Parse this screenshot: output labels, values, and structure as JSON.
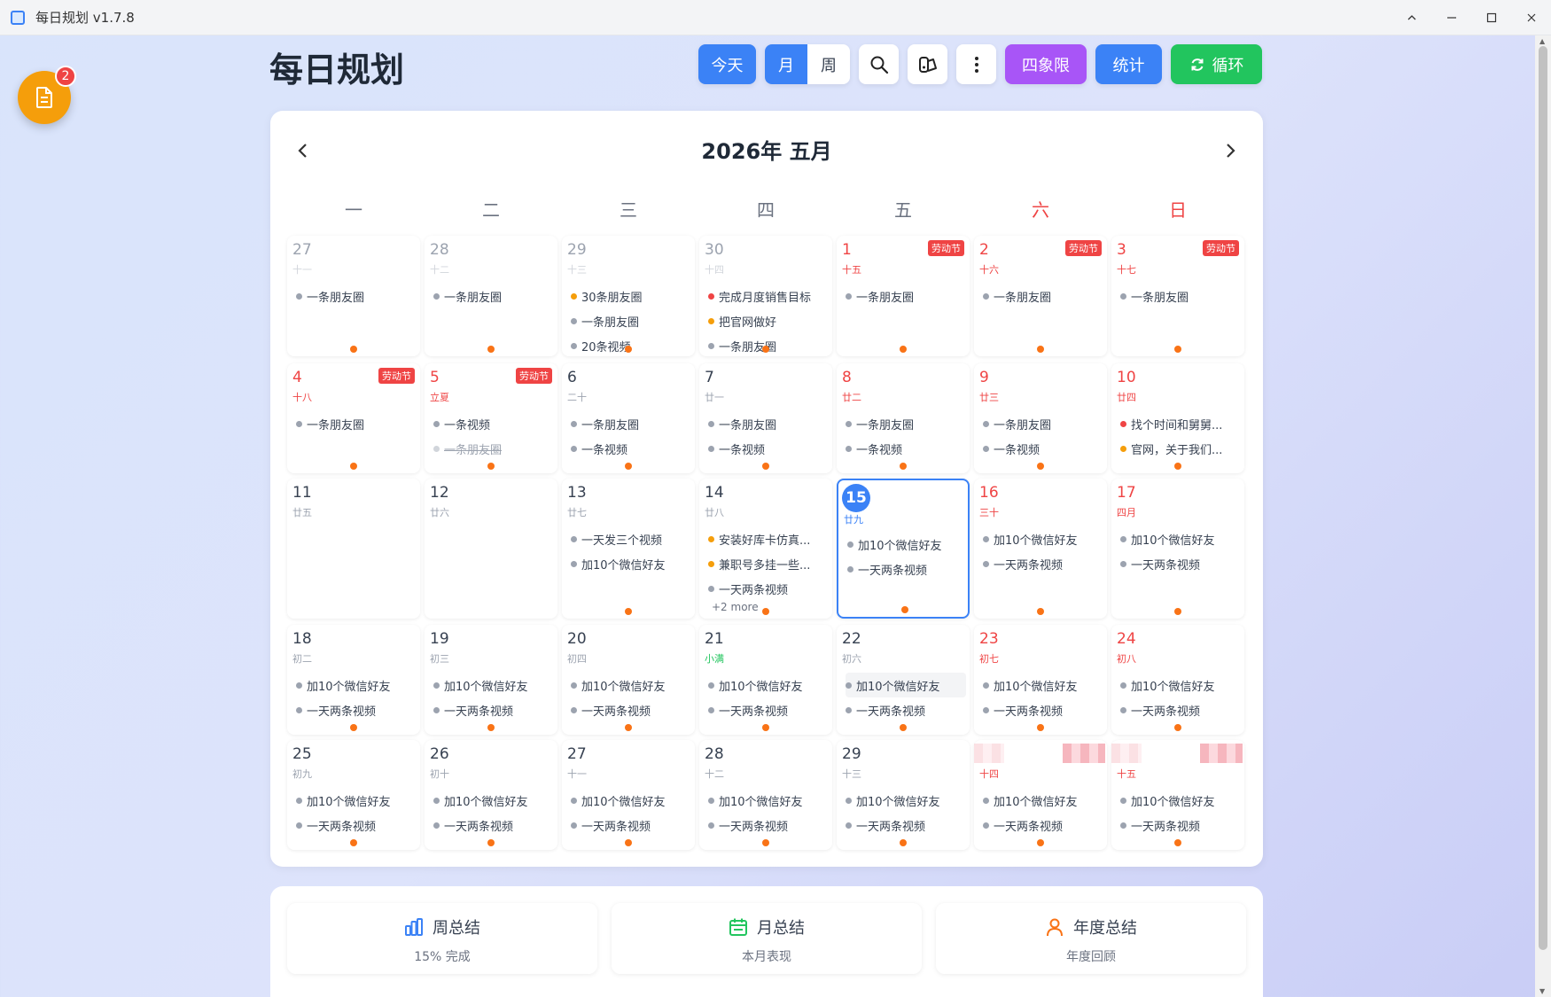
{
  "window": {
    "title": "每日规划 v1.7.8"
  },
  "float_badge": "2",
  "header": {
    "title": "每日规划",
    "today": "今天",
    "month": "月",
    "week": "周",
    "quadrant": "四象限",
    "stats": "统计",
    "cycle": "循环"
  },
  "calendar": {
    "title": "2026年 五月",
    "weekdays": [
      "一",
      "二",
      "三",
      "四",
      "五",
      "六",
      "日"
    ],
    "holiday_label": "劳动节",
    "more_label": "+2 more",
    "cells": [
      {
        "d": "27",
        "l": "十一",
        "tasks": [
          [
            "g",
            "一条朋友圈"
          ]
        ]
      },
      {
        "d": "28",
        "l": "十二",
        "tasks": [
          [
            "g",
            "一条朋友圈"
          ]
        ]
      },
      {
        "d": "29",
        "l": "十三",
        "tasks": [
          [
            "y",
            "30条朋友圈"
          ],
          [
            "g",
            "一条朋友圈"
          ],
          [
            "g",
            "20条视频"
          ]
        ]
      },
      {
        "d": "30",
        "l": "十四",
        "tasks": [
          [
            "r",
            "完成月度销售目标"
          ],
          [
            "y",
            "把官网做好"
          ],
          [
            "g",
            "一条朋友圈"
          ]
        ]
      },
      {
        "d": "1",
        "l": "十五",
        "tasks": [
          [
            "g",
            "一条朋友圈"
          ]
        ]
      },
      {
        "d": "2",
        "l": "十六",
        "tasks": [
          [
            "g",
            "一条朋友圈"
          ]
        ]
      },
      {
        "d": "3",
        "l": "十七",
        "tasks": [
          [
            "g",
            "一条朋友圈"
          ]
        ]
      },
      {
        "d": "4",
        "l": "十八",
        "tasks": [
          [
            "g",
            "一条朋友圈"
          ]
        ]
      },
      {
        "d": "5",
        "l": "立夏",
        "tasks": [
          [
            "g",
            "一条视频"
          ],
          [
            "x",
            "一条朋友圈"
          ]
        ]
      },
      {
        "d": "6",
        "l": "二十",
        "tasks": [
          [
            "g",
            "一条朋友圈"
          ],
          [
            "g",
            "一条视频"
          ]
        ]
      },
      {
        "d": "7",
        "l": "廿一",
        "tasks": [
          [
            "g",
            "一条朋友圈"
          ],
          [
            "g",
            "一条视频"
          ]
        ]
      },
      {
        "d": "8",
        "l": "廿二",
        "tasks": [
          [
            "g",
            "一条朋友圈"
          ],
          [
            "g",
            "一条视频"
          ]
        ]
      },
      {
        "d": "9",
        "l": "廿三",
        "tasks": [
          [
            "g",
            "一条朋友圈"
          ],
          [
            "g",
            "一条视频"
          ]
        ]
      },
      {
        "d": "10",
        "l": "廿四",
        "tasks": [
          [
            "r",
            "找个时间和舅舅..."
          ],
          [
            "y",
            "官网，关于我们..."
          ]
        ]
      },
      {
        "d": "11",
        "l": "廿五",
        "tasks": []
      },
      {
        "d": "12",
        "l": "廿六",
        "tasks": []
      },
      {
        "d": "13",
        "l": "廿七",
        "tasks": [
          [
            "g",
            "一天发三个视频"
          ],
          [
            "g",
            "加10个微信好友"
          ]
        ]
      },
      {
        "d": "14",
        "l": "廿八",
        "tasks": [
          [
            "y",
            "安装好库卡仿真..."
          ],
          [
            "y",
            "兼职号多挂一些..."
          ],
          [
            "g",
            "一天两条视频"
          ]
        ]
      },
      {
        "d": "15",
        "l": "廿九",
        "tasks": [
          [
            "g",
            "加10个微信好友"
          ],
          [
            "g",
            "一天两条视频"
          ]
        ]
      },
      {
        "d": "16",
        "l": "三十",
        "tasks": [
          [
            "g",
            "加10个微信好友"
          ],
          [
            "g",
            "一天两条视频"
          ]
        ]
      },
      {
        "d": "17",
        "l": "四月",
        "tasks": [
          [
            "g",
            "加10个微信好友"
          ],
          [
            "g",
            "一天两条视频"
          ]
        ]
      },
      {
        "d": "18",
        "l": "初二",
        "tasks": [
          [
            "g",
            "加10个微信好友"
          ],
          [
            "g",
            "一天两条视频"
          ]
        ]
      },
      {
        "d": "19",
        "l": "初三",
        "tasks": [
          [
            "g",
            "加10个微信好友"
          ],
          [
            "g",
            "一天两条视频"
          ]
        ]
      },
      {
        "d": "20",
        "l": "初四",
        "tasks": [
          [
            "g",
            "加10个微信好友"
          ],
          [
            "g",
            "一天两条视频"
          ]
        ]
      },
      {
        "d": "21",
        "l": "小满",
        "tasks": [
          [
            "g",
            "加10个微信好友"
          ],
          [
            "g",
            "一天两条视频"
          ]
        ]
      },
      {
        "d": "22",
        "l": "初六",
        "tasks": [
          [
            "g",
            "加10个微信好友"
          ],
          [
            "g",
            "一天两条视频"
          ]
        ]
      },
      {
        "d": "23",
        "l": "初七",
        "tasks": [
          [
            "g",
            "加10个微信好友"
          ],
          [
            "g",
            "一天两条视频"
          ]
        ]
      },
      {
        "d": "24",
        "l": "初八",
        "tasks": [
          [
            "g",
            "加10个微信好友"
          ],
          [
            "g",
            "一天两条视频"
          ]
        ]
      },
      {
        "d": "25",
        "l": "初九",
        "tasks": [
          [
            "g",
            "加10个微信好友"
          ],
          [
            "g",
            "一天两条视频"
          ]
        ]
      },
      {
        "d": "26",
        "l": "初十",
        "tasks": [
          [
            "g",
            "加10个微信好友"
          ],
          [
            "g",
            "一天两条视频"
          ]
        ]
      },
      {
        "d": "27",
        "l": "十一",
        "tasks": [
          [
            "g",
            "加10个微信好友"
          ],
          [
            "g",
            "一天两条视频"
          ]
        ]
      },
      {
        "d": "28",
        "l": "十二",
        "tasks": [
          [
            "g",
            "加10个微信好友"
          ],
          [
            "g",
            "一天两条视频"
          ]
        ]
      },
      {
        "d": "29",
        "l": "十三",
        "tasks": [
          [
            "g",
            "加10个微信好友"
          ],
          [
            "g",
            "一天两条视频"
          ]
        ]
      },
      {
        "d": "",
        "l": "十四",
        "tasks": [
          [
            "g",
            "加10个微信好友"
          ],
          [
            "g",
            "一天两条视频"
          ]
        ]
      },
      {
        "d": "",
        "l": "十五",
        "tasks": [
          [
            "g",
            "加10个微信好友"
          ],
          [
            "g",
            "一天两条视频"
          ]
        ]
      }
    ]
  },
  "summary": {
    "week": {
      "title": "周总结",
      "sub": "15% 完成"
    },
    "month": {
      "title": "月总结",
      "sub": "本月表现"
    },
    "year": {
      "title": "年度总结",
      "sub": "年度回顾"
    }
  },
  "colors": {
    "accent": "#3b82f6",
    "purple": "#a855f7",
    "green": "#22c55e",
    "red": "#ef4444",
    "orange": "#f97316"
  }
}
